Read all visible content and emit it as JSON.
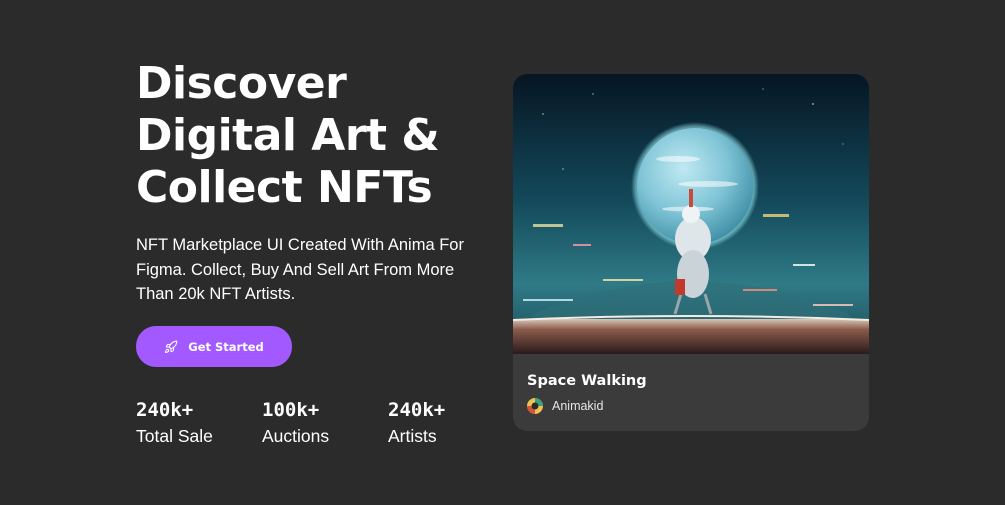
{
  "hero": {
    "title_lines": [
      "Discover",
      "Digital Art &",
      "Collect NFTs"
    ],
    "subtitle": "NFT Marketplace UI Created With Anima For Figma. Collect, Buy And Sell Art From More Than 20k NFT Artists.",
    "cta_label": "Get Started",
    "cta_icon": "rocket-icon"
  },
  "stats": [
    {
      "value": "240k+",
      "label": "Total Sale"
    },
    {
      "value": "100k+",
      "label": "Auctions"
    },
    {
      "value": "240k+",
      "label": "Artists"
    }
  ],
  "card": {
    "title": "Space Walking",
    "artist": "Animakid"
  },
  "colors": {
    "background": "#2b2b2b",
    "accent": "#a259ff",
    "card_background": "#3b3b3b",
    "text": "#ffffff"
  }
}
